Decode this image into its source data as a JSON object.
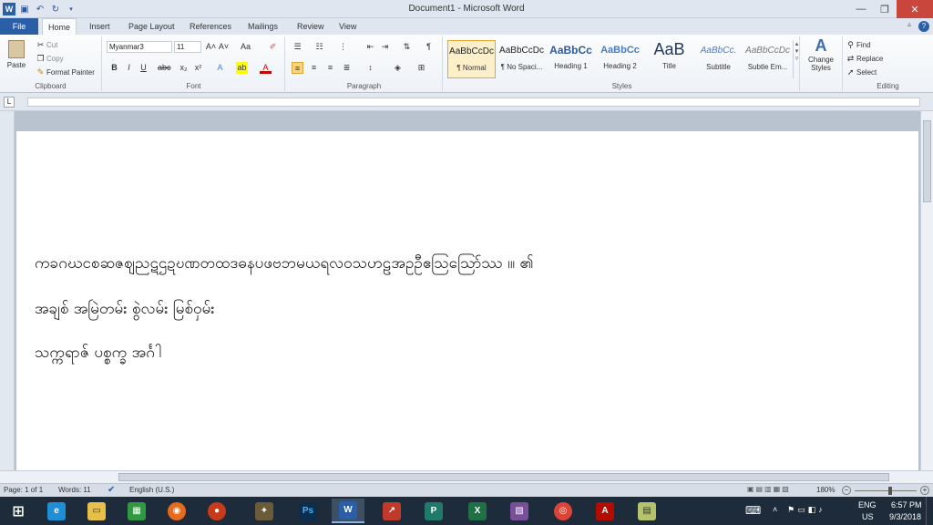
{
  "window": {
    "title": "Document1 - Microsoft Word"
  },
  "tabs": [
    "File",
    "Home",
    "Insert",
    "Page Layout",
    "References",
    "Mailings",
    "Review",
    "View"
  ],
  "clipboard": {
    "paste": "Paste",
    "cut": "Cut",
    "copy": "Copy",
    "format_painter": "Format Painter",
    "label": "Clipboard"
  },
  "font": {
    "name": "Myanmar3",
    "size": "11",
    "label": "Font"
  },
  "paragraph": {
    "label": "Paragraph"
  },
  "styles": {
    "items": [
      {
        "preview": "AaBbCcDc",
        "name": "¶ Normal"
      },
      {
        "preview": "AaBbCcDc",
        "name": "¶ No Spaci..."
      },
      {
        "preview": "AaBbCc",
        "name": "Heading 1"
      },
      {
        "preview": "AaBbCc",
        "name": "Heading 2"
      },
      {
        "preview": "AaB",
        "name": "Title"
      },
      {
        "preview": "AaBbCc.",
        "name": "Subtitle"
      },
      {
        "preview": "AaBbCcDc",
        "name": "Subtle Em..."
      }
    ],
    "change": "Change Styles",
    "label": "Styles"
  },
  "editing": {
    "find": "Find",
    "replace": "Replace",
    "select": "Select",
    "label": "Editing"
  },
  "document": {
    "lines": [
      "ကခဂဃငစဆဇဈညဋဌဍဎဏတထဒဓနပဖဗဘမယရလဝသဟဠအဥဦဧဩဪဿ ၊။ ၏",
      "အချစ် အမြဲတမ်း စွဲလမ်း မြစ်ဝှမ်း",
      "သက္ကရာဇ် ပစ္စက္ခ အင်္ဂါ"
    ]
  },
  "status": {
    "page": "Page: 1 of 1",
    "words": "Words: 11",
    "language": "English (U.S.)",
    "zoom": "180%"
  },
  "taskbar": {
    "lang": "ENG",
    "region": "US",
    "time": "6:57 PM",
    "date": "9/3/2018",
    "ps_label": "Ps",
    "word_label": "W"
  }
}
